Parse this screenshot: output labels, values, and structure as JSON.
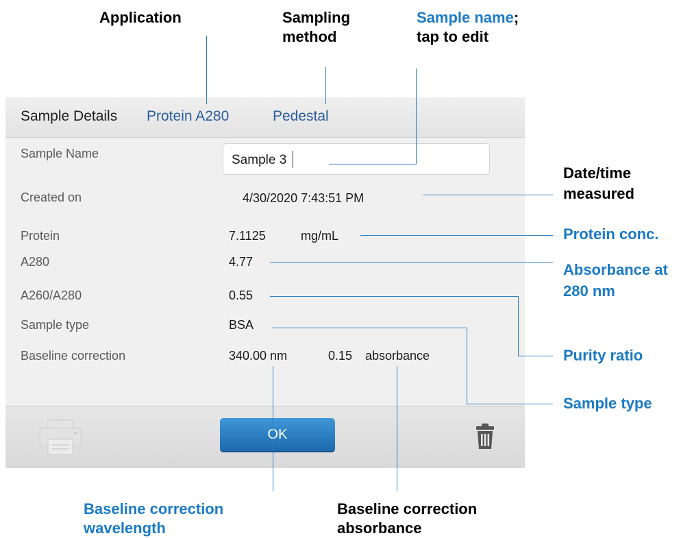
{
  "callouts": {
    "application": "Application",
    "sampling_method_1": "Sampling",
    "sampling_method_2": "method",
    "sample_name_1": "Sample name",
    "sample_name_1_suffix": ";",
    "sample_name_2": "tap to edit",
    "datetime_1": "Date/time",
    "datetime_2": "measured",
    "protein_conc": "Protein conc.",
    "absorbance_1": "Absorbance at",
    "absorbance_2": "280 nm",
    "purity_ratio": "Purity ratio",
    "sample_type": "Sample type",
    "baseline_wavelength_1": "Baseline correction",
    "baseline_wavelength_2": "wavelength",
    "baseline_absorbance_1": "Baseline correction",
    "baseline_absorbance_2": "absorbance"
  },
  "header": {
    "title": "Sample Details",
    "application": "Protein A280",
    "method": "Pedestal"
  },
  "fields": {
    "sample_name": {
      "label": "Sample Name",
      "value": "Sample 3"
    },
    "created_on": {
      "label": "Created on",
      "value": "4/30/2020 7:43:51 PM"
    },
    "protein": {
      "label": "Protein",
      "value": "7.1125",
      "unit": "mg/mL"
    },
    "a280": {
      "label": "A280",
      "value": "4.77"
    },
    "ratio": {
      "label": "A260/A280",
      "value": "0.55"
    },
    "sample_type": {
      "label": "Sample type",
      "value": "BSA"
    },
    "baseline": {
      "label": "Baseline correction",
      "wavelength": "340.00 nm",
      "absorbance_value": "0.15",
      "absorbance_unit": "absorbance"
    }
  },
  "footer": {
    "ok_label": "OK",
    "print_icon": "printer-icon",
    "delete_icon": "trash-icon"
  },
  "colors": {
    "accent": "#1a7ac4",
    "leader_line": "#2f7fbe",
    "ok_button": "#2a7fc4"
  }
}
